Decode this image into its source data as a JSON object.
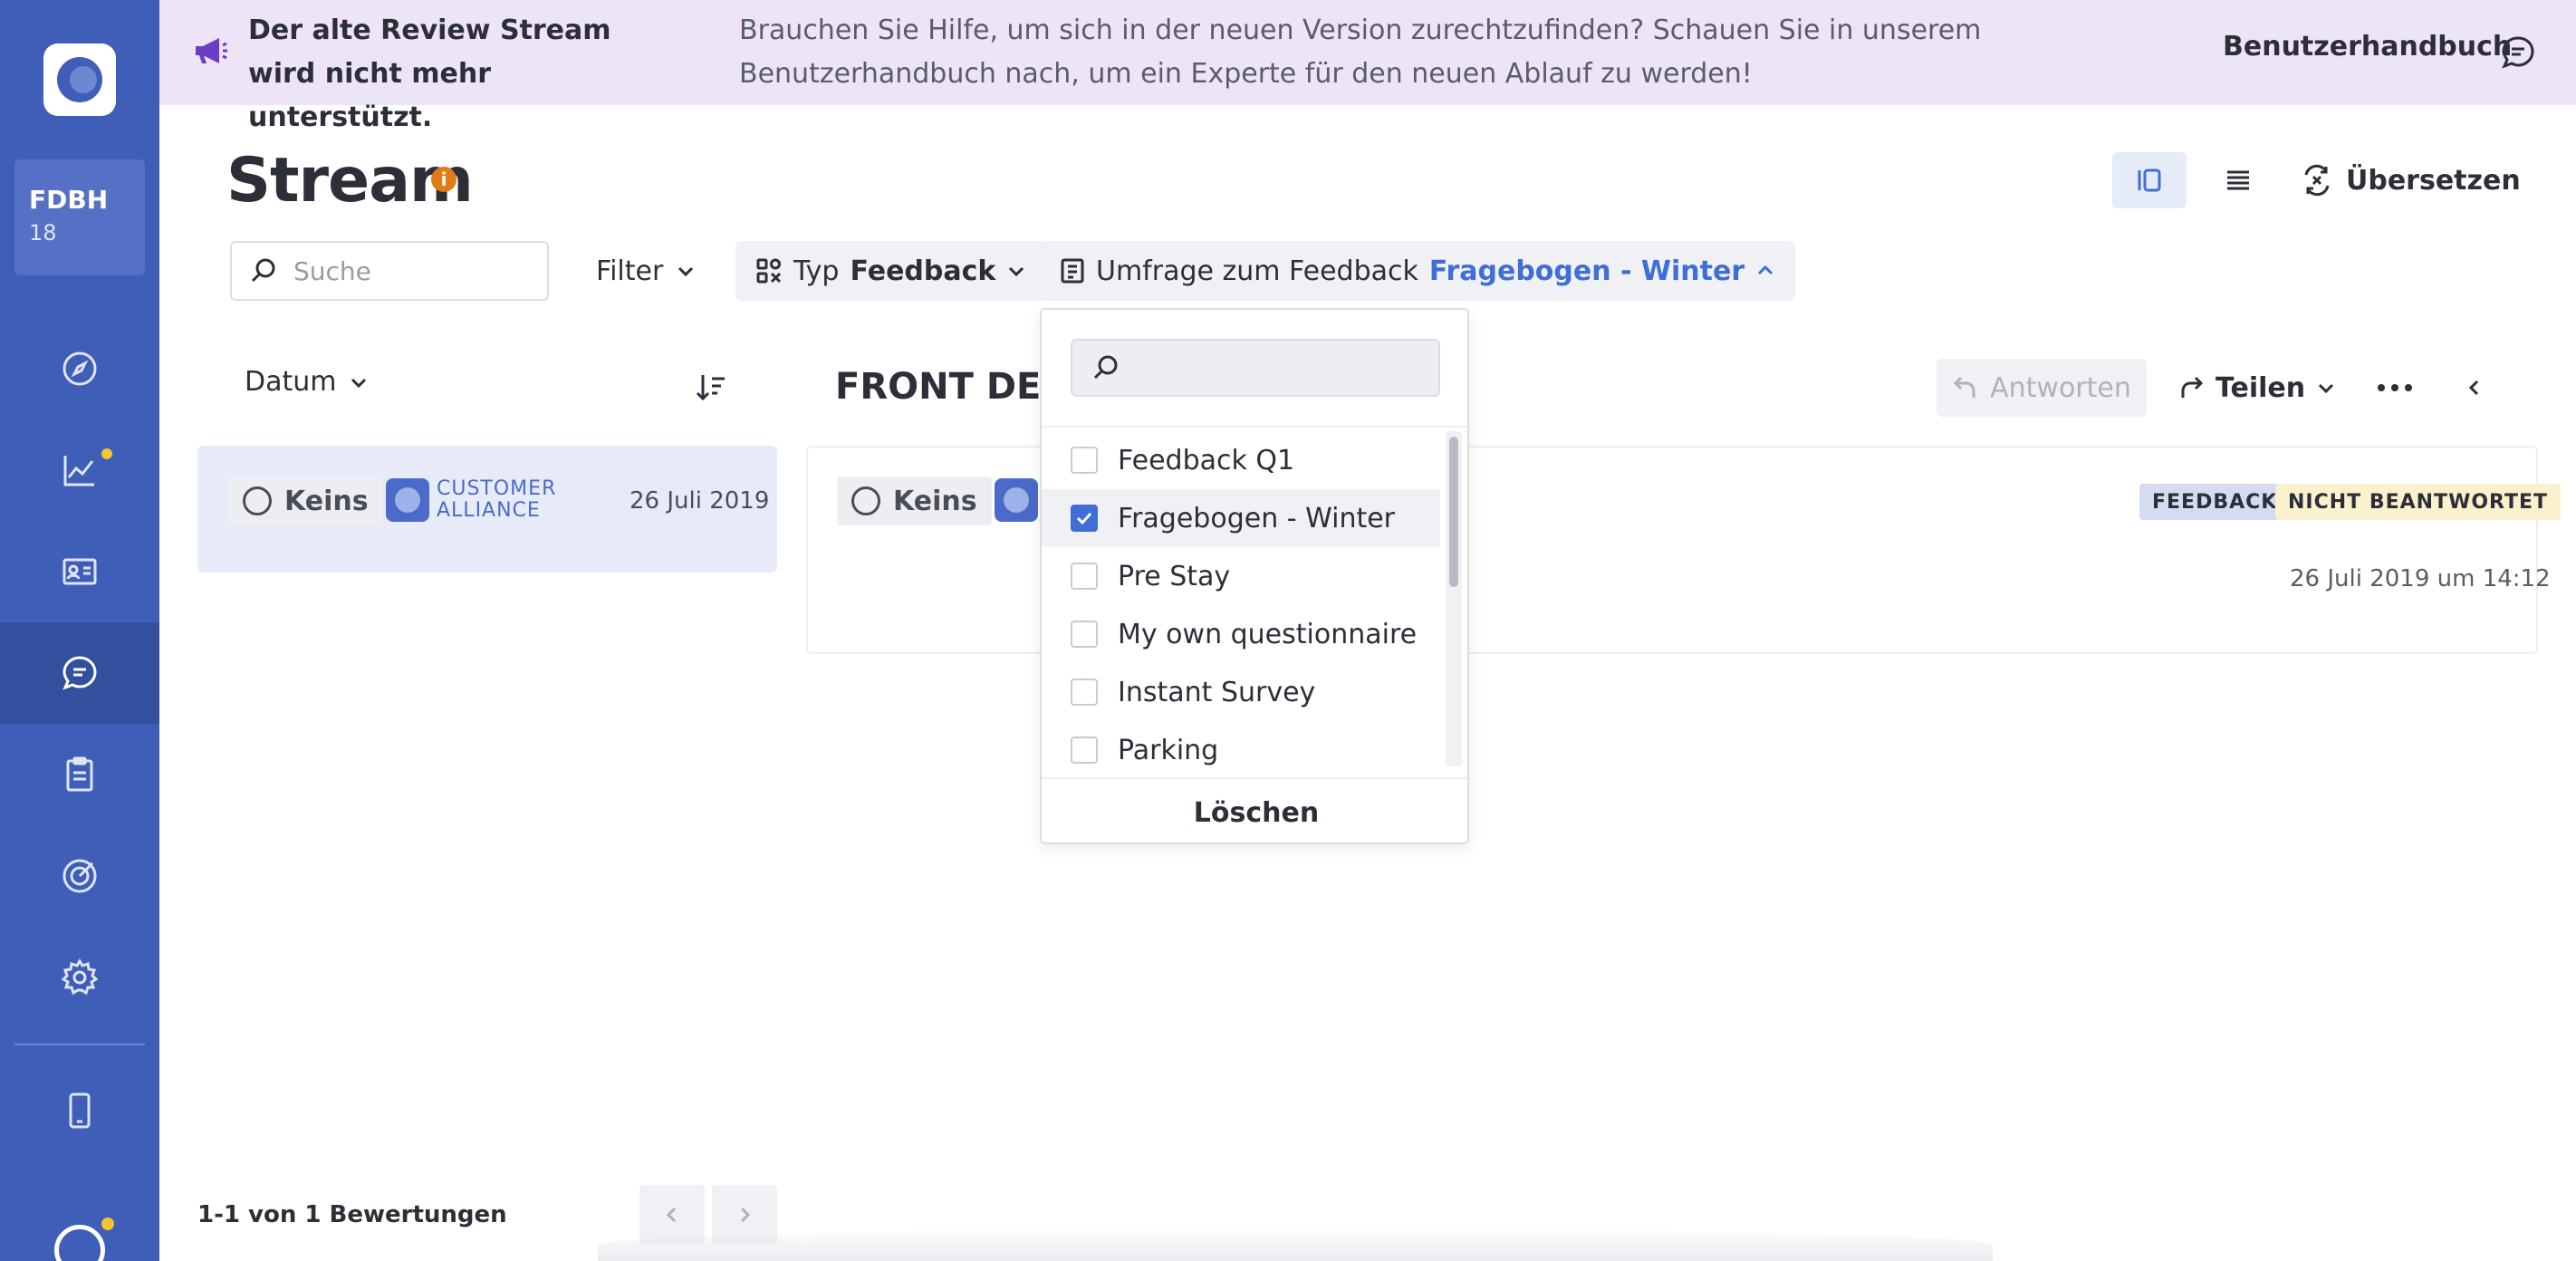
{
  "sidebar": {
    "account": {
      "name": "FDBH",
      "number": "18"
    },
    "items": [
      {
        "icon": "compass-icon"
      },
      {
        "icon": "chart-icon"
      },
      {
        "icon": "contact-card-icon"
      },
      {
        "icon": "chat-icon"
      },
      {
        "icon": "clipboard-icon"
      },
      {
        "icon": "target-icon"
      },
      {
        "icon": "gear-icon"
      },
      {
        "icon": "mobile-icon"
      }
    ]
  },
  "banner": {
    "title": "Der alte Review Stream wird nicht mehr unterstützt.",
    "text": "Brauchen Sie Hilfe, um sich in der neuen Version zurechtzufinden? Schauen Sie in unserem Benutzerhandbuch nach, um ein Experte für den neuen Ablauf zu werden!",
    "link": "Benutzerhandbuch"
  },
  "header": {
    "title": "Stream",
    "info": "i",
    "translate_label": "Übersetzen"
  },
  "filters": {
    "search_placeholder": "Suche",
    "filter_label": "Filter",
    "type_prefix": "Typ",
    "type_value": "Feedback",
    "survey_prefix": "Umfrage zum Feedback",
    "survey_value": "Fragebogen - Winter"
  },
  "list": {
    "sort_label": "Datum",
    "card": {
      "status": "Keins",
      "source_line1": "CUSTOMER",
      "source_line2": "ALLIANCE",
      "date": "26 Juli 2019"
    },
    "pagination": "1-1 von 1 Bewertungen"
  },
  "detail": {
    "title": "FRONT DESK",
    "reply_label": "Antworten",
    "share_label": "Teilen",
    "status": "Keins",
    "tags": [
      "FEEDBACK",
      "NICHT BEANTWORTET"
    ],
    "datetime": "26 Juli 2019 um 14:12"
  },
  "dropdown": {
    "search_value": "",
    "options": [
      {
        "label": "Feedback Q1",
        "checked": false
      },
      {
        "label": "Fragebogen - Winter",
        "checked": true
      },
      {
        "label": "Pre Stay",
        "checked": false
      },
      {
        "label": "My own questionnaire",
        "checked": false
      },
      {
        "label": "Instant Survey",
        "checked": false
      },
      {
        "label": "Parking",
        "checked": false
      }
    ],
    "clear_label": "Löschen"
  },
  "colors": {
    "sidebar": "#3f5eb8",
    "banner": "#ede4f8",
    "accent": "#3f6ed6",
    "info": "#e07b16"
  }
}
